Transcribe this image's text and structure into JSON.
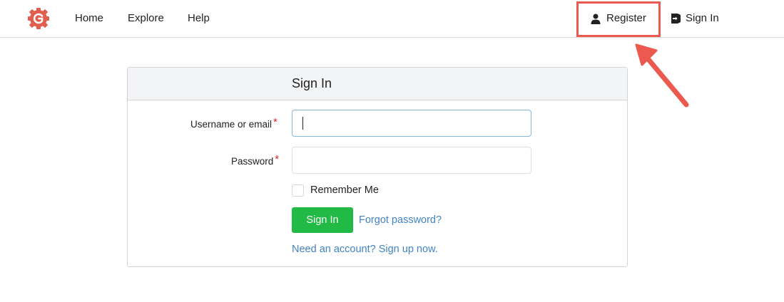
{
  "nav": {
    "logo_icon": "gogs-gear-icon",
    "home": "Home",
    "explore": "Explore",
    "help": "Help",
    "register": "Register",
    "sign_in": "Sign In"
  },
  "annotation": {
    "highlight_color": "#ec5a4f"
  },
  "form": {
    "title": "Sign In",
    "username_label": "Username or email",
    "password_label": "Password",
    "required_mark": "*",
    "username_value": "",
    "password_value": "",
    "remember_label": "Remember Me",
    "remember_checked": false,
    "submit_label": "Sign In",
    "forgot_link": "Forgot password?",
    "signup_link": "Need an account? Sign up now."
  },
  "colors": {
    "primary_green": "#21ba45",
    "link_blue": "#4183c4",
    "required_red": "#db2828"
  }
}
